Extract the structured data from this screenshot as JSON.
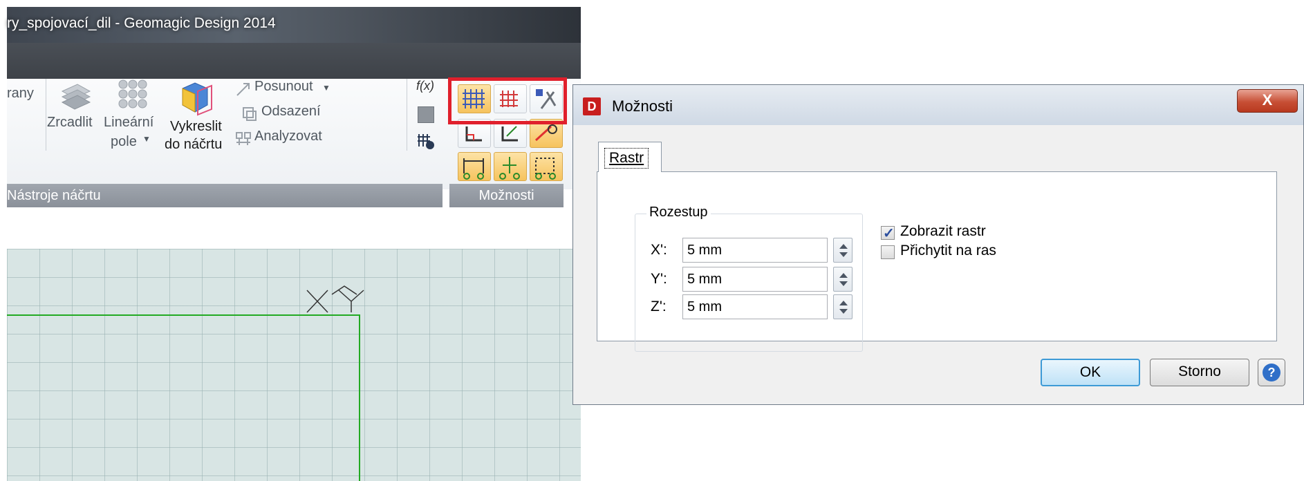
{
  "app": {
    "title": "ry_spojovací_dil - Geomagic Design 2014",
    "ribbon": {
      "left_cut_label": "rany",
      "zrcadlit": "Zrcadlit",
      "linearni_line1": "Lineární",
      "linearni_line2": "pole",
      "vykreslit_line1": "Vykreslit",
      "vykreslit_line2": "do náčrtu",
      "posunout": "Posunout",
      "odsazeni": "Odsazení",
      "analyzovat": "Analyzovat",
      "fx": "f(x)",
      "group_nastroje": "Nástroje náčrtu",
      "group_moznosti": "Možnosti"
    },
    "colors": {
      "highlight": "#e0202c",
      "grid_bg": "#d8e5e4",
      "sketch_line": "#22aa22"
    }
  },
  "dialog": {
    "title": "Možnosti",
    "close_label": "X",
    "tab_label": "Rastr",
    "group_label": "Rozestup",
    "fields": [
      {
        "label": "X':",
        "value": "5 mm"
      },
      {
        "label": "Y':",
        "value": "5 mm"
      },
      {
        "label": "Z':",
        "value": "5 mm"
      }
    ],
    "checkboxes": [
      {
        "label": "Zobrazit rastr",
        "checked": true
      },
      {
        "label": "Přichytit na ras",
        "checked": false
      }
    ],
    "ok_label": "OK",
    "cancel_label": "Storno",
    "help_label": "?"
  }
}
